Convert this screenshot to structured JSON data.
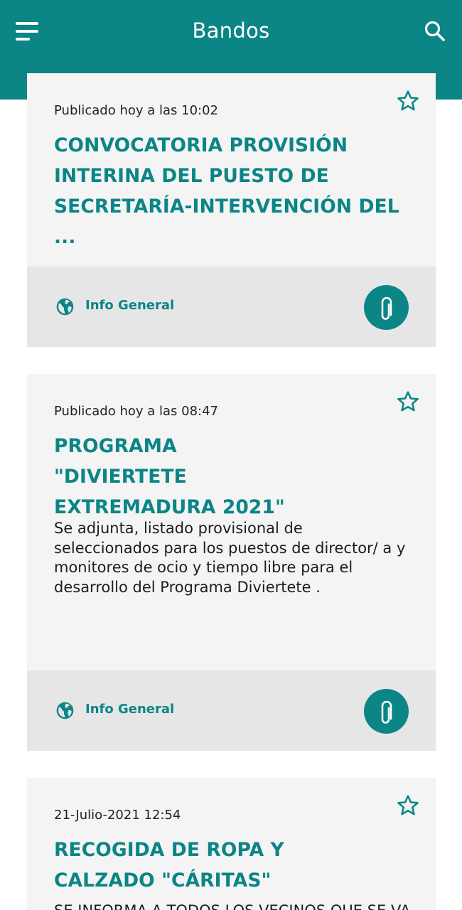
{
  "header": {
    "title": "Bandos"
  },
  "bandos": [
    {
      "date": "Publicado hoy a las 10:02",
      "title": "CONVOCATORIA PROVISIÓN INTERINA DEL PUESTO DE SECRETARÍA-INTERVENCIÓN DEL ...",
      "category": "Info General"
    },
    {
      "date": "Publicado hoy a las 08:47",
      "title": "PROGRAMA  \"DIVIERTETE EXTREMADURA 2021\"",
      "body": "Se adjunta,  listado provisional de seleccionados para los puestos de director/ a y monitores de ocio y tiempo libre  para el desarrollo del Programa Diviertete .",
      "category": "Info General"
    },
    {
      "date": "21-Julio-2021 12:54",
      "title": "RECOGIDA DE ROPA  Y CALZADO \"CÁRITAS\"",
      "body": "SE INFORMA A TODOS LOS VECINOS QUE SE VA"
    }
  ],
  "icons": {
    "menu": "menu-icon",
    "search": "search-icon",
    "favorite": "star-outline-icon",
    "category": "globe-icon",
    "attachment": "paperclip-icon"
  },
  "colors": {
    "primary": "#0b8586",
    "card_background": "#f4f4f4",
    "card_footer": "#e6e6e6"
  }
}
